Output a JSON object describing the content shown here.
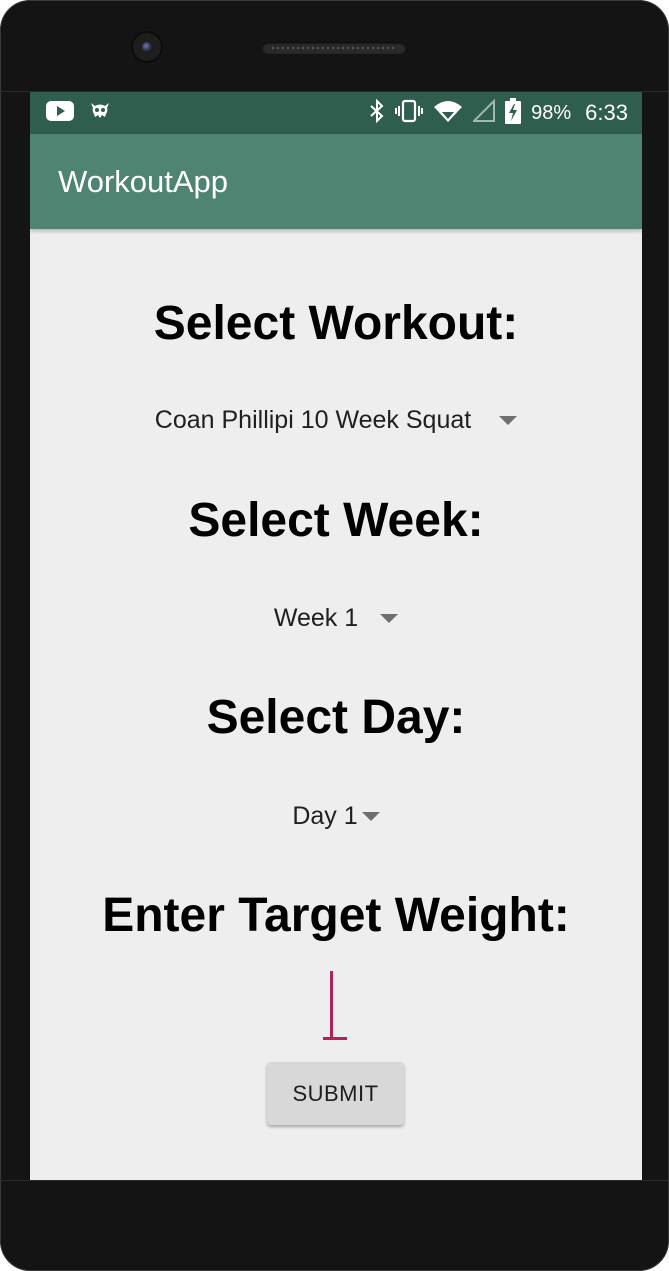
{
  "status_bar": {
    "left_icons": [
      "youtube-icon",
      "android-debug-icon"
    ],
    "right_icons": [
      "bluetooth-icon",
      "vibrate-icon",
      "wifi-icon",
      "cell-signal-icon",
      "battery-charging-icon"
    ],
    "battery_percent": "98%",
    "time": "6:33",
    "background_color": "#2f5e4e"
  },
  "app_bar": {
    "title": "WorkoutApp",
    "background_color": "#4e8471"
  },
  "form": {
    "workout": {
      "heading": "Select Workout:",
      "selected": "Coan Phillipi 10 Week Squat"
    },
    "week": {
      "heading": "Select Week:",
      "selected": "Week 1"
    },
    "day": {
      "heading": "Select Day:",
      "selected": "Day 1"
    },
    "weight": {
      "heading": "Enter Target Weight:",
      "value": "",
      "cursor_color": "#b0245c"
    },
    "submit_label": "SUBMIT"
  }
}
